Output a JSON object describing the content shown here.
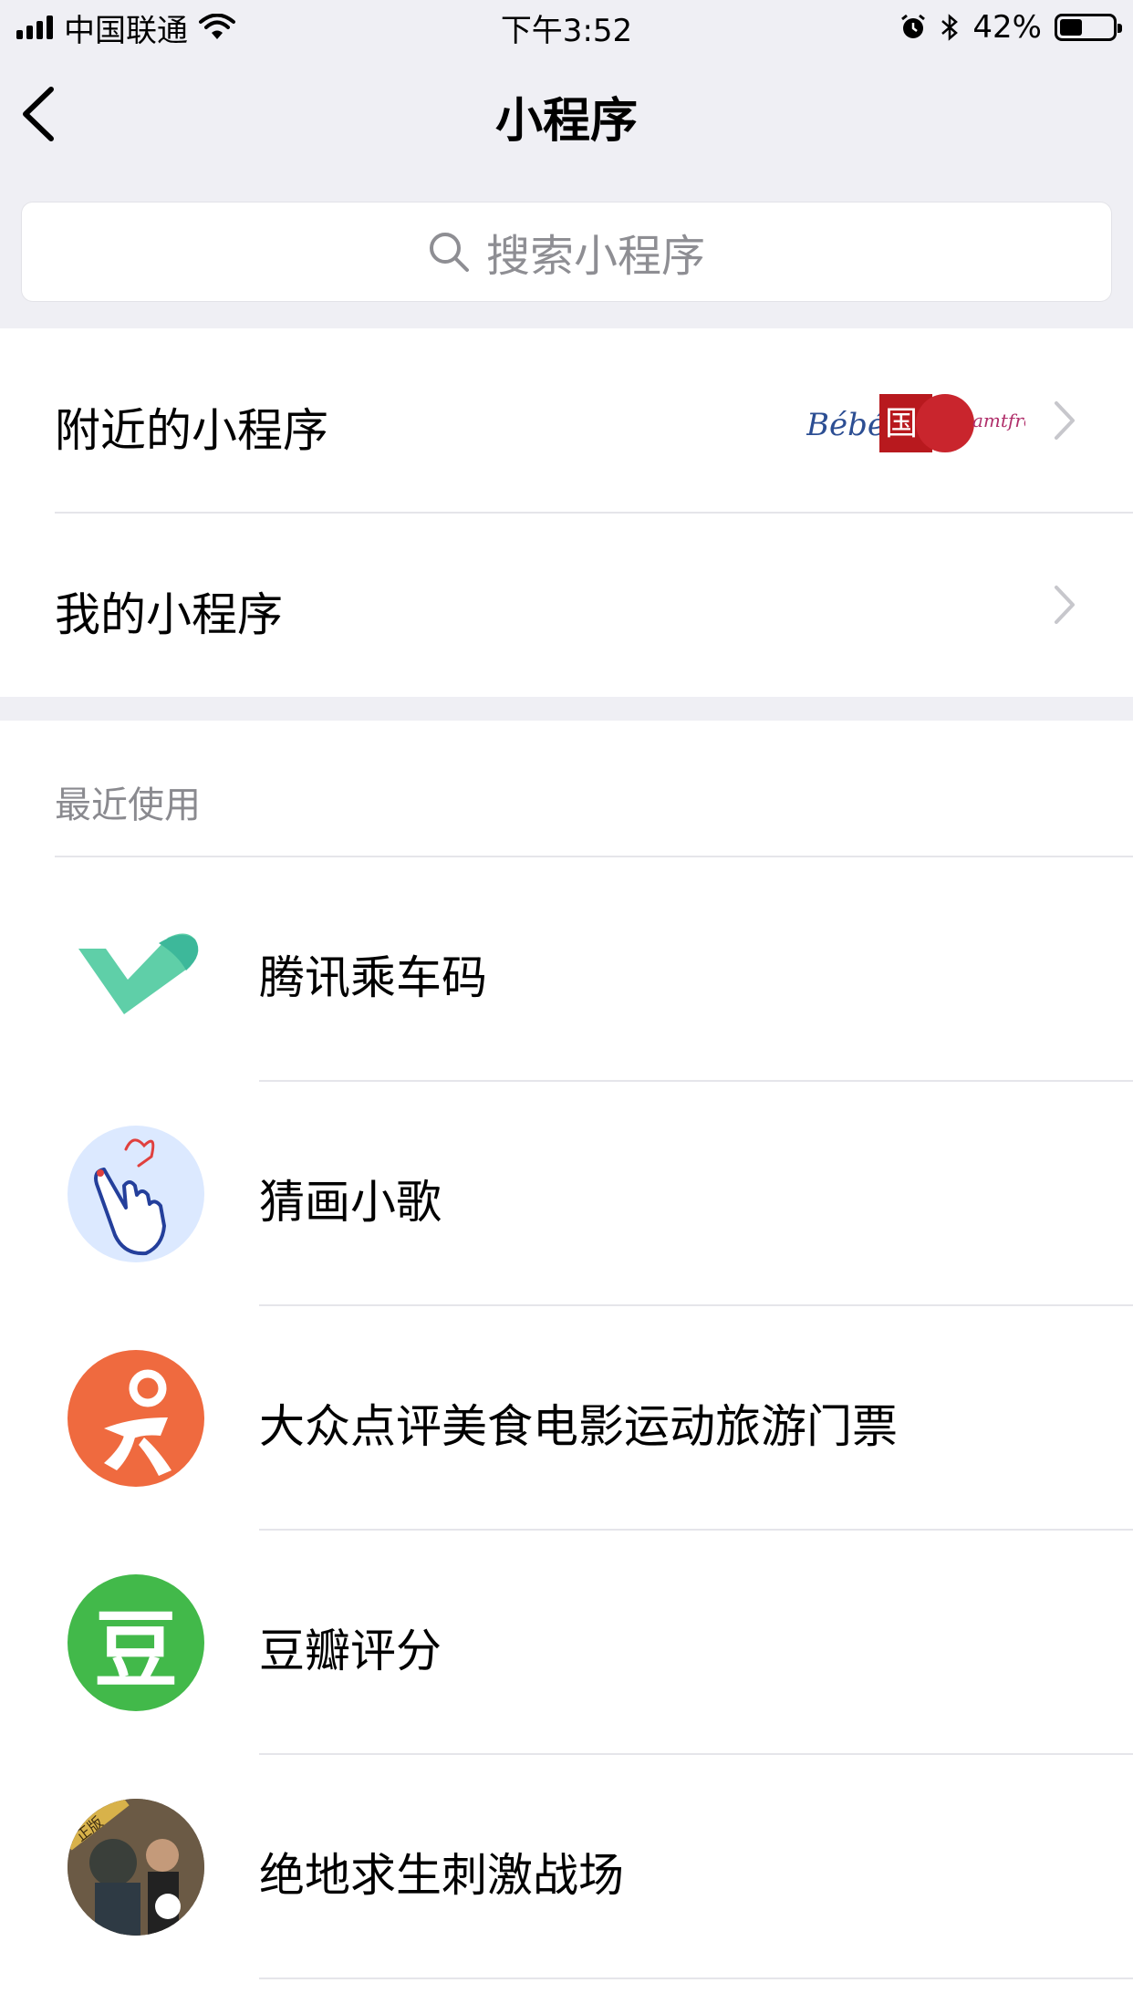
{
  "status_bar": {
    "carrier": "中国联通",
    "time": "下午3:52",
    "battery": "42%",
    "battery_level": 0.42,
    "icons": [
      "signal-icon",
      "wifi-icon",
      "alarm-icon",
      "bluetooth-icon",
      "battery-icon"
    ]
  },
  "nav": {
    "title": "小程序",
    "back_icon": "chevron-left-icon"
  },
  "search": {
    "placeholder": "搜索小程序",
    "icon": "search-icon"
  },
  "menu": {
    "nearby_label": "附近的小程序",
    "mine_label": "我的小程序",
    "thumbnail_texts": [
      "Bébé",
      "国",
      "amtfree"
    ]
  },
  "recent": {
    "title": "最近使用",
    "items": [
      {
        "name": "腾讯乘车码",
        "icon": "tencent-ride-code-icon",
        "color": "#5fcfa8"
      },
      {
        "name": "猜画小歌",
        "icon": "pointing-hand-icon",
        "color": "#dce9ff"
      },
      {
        "name": "大众点评美食电影运动旅游门票",
        "icon": "dianping-icon",
        "color": "#ef6a3f"
      },
      {
        "name": "豆瓣评分",
        "icon": "douban-icon",
        "color": "#42b94a",
        "glyph": "豆"
      },
      {
        "name": "绝地求生刺激战场",
        "icon": "pubg-avatar-icon",
        "color": "#3d3d3d",
        "badge": "正版"
      }
    ]
  }
}
